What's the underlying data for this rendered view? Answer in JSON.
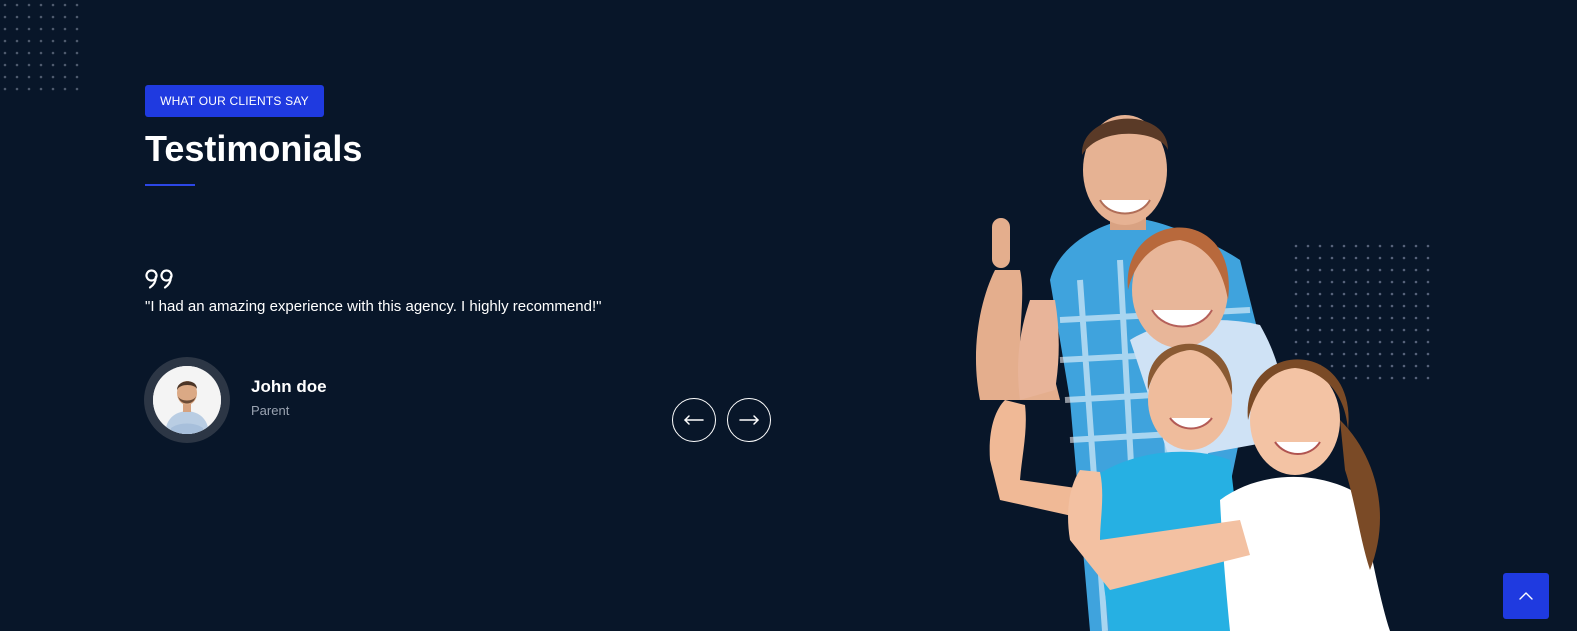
{
  "section": {
    "tag_label": "WHAT OUR CLIENTS SAY",
    "title": "Testimonials"
  },
  "testimonial": {
    "quote": "\"I had an amazing experience with this agency. I highly recommend!\"",
    "author_name": "John doe",
    "author_role": "Parent"
  },
  "icons": {
    "quote": "quote-icon",
    "prev": "arrow-left-icon",
    "next": "arrow-right-icon",
    "back_to_top": "chevron-up-icon"
  },
  "colors": {
    "background": "#081629",
    "accent": "#1f3ae0",
    "text": "#ffffff",
    "muted_text": "#9aa3b1"
  }
}
